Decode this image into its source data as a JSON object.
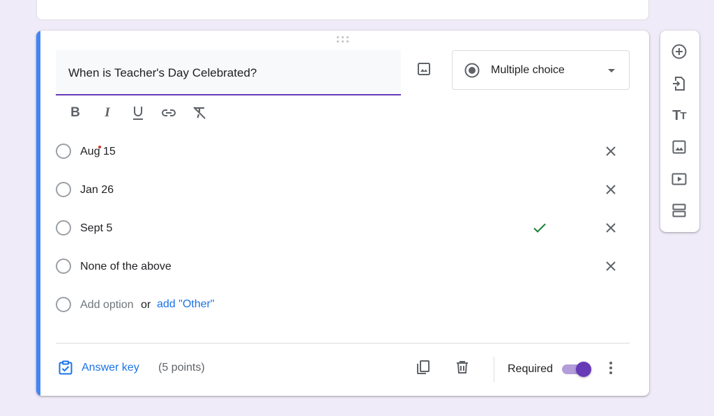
{
  "question": {
    "title": "When is Teacher's Day Celebrated?",
    "type_label": "Multiple choice"
  },
  "format_toolbar": [
    "bold-icon",
    "italic-icon",
    "underline-icon",
    "link-icon",
    "clear-format-icon"
  ],
  "options": [
    {
      "label": "Aug 15",
      "correct": false
    },
    {
      "label": "Jan 26",
      "correct": false
    },
    {
      "label": "Sept 5",
      "correct": true
    },
    {
      "label": "None of the above",
      "correct": false
    }
  ],
  "add_option": {
    "label": "Add option",
    "or": "or",
    "other_link": "add \"Other\""
  },
  "footer": {
    "answer_key": "Answer key",
    "points": "(5 points)",
    "required_label": "Required",
    "required_on": true
  },
  "side_toolbar": [
    "add-question-icon",
    "import-questions-icon",
    "add-title-icon",
    "add-image-icon",
    "add-video-icon",
    "add-section-icon"
  ],
  "colors": {
    "accent": "#673ab7",
    "card_accent": "#4285f4",
    "link": "#1a73e8",
    "correct": "#188038",
    "background": "#f0ebf8"
  }
}
